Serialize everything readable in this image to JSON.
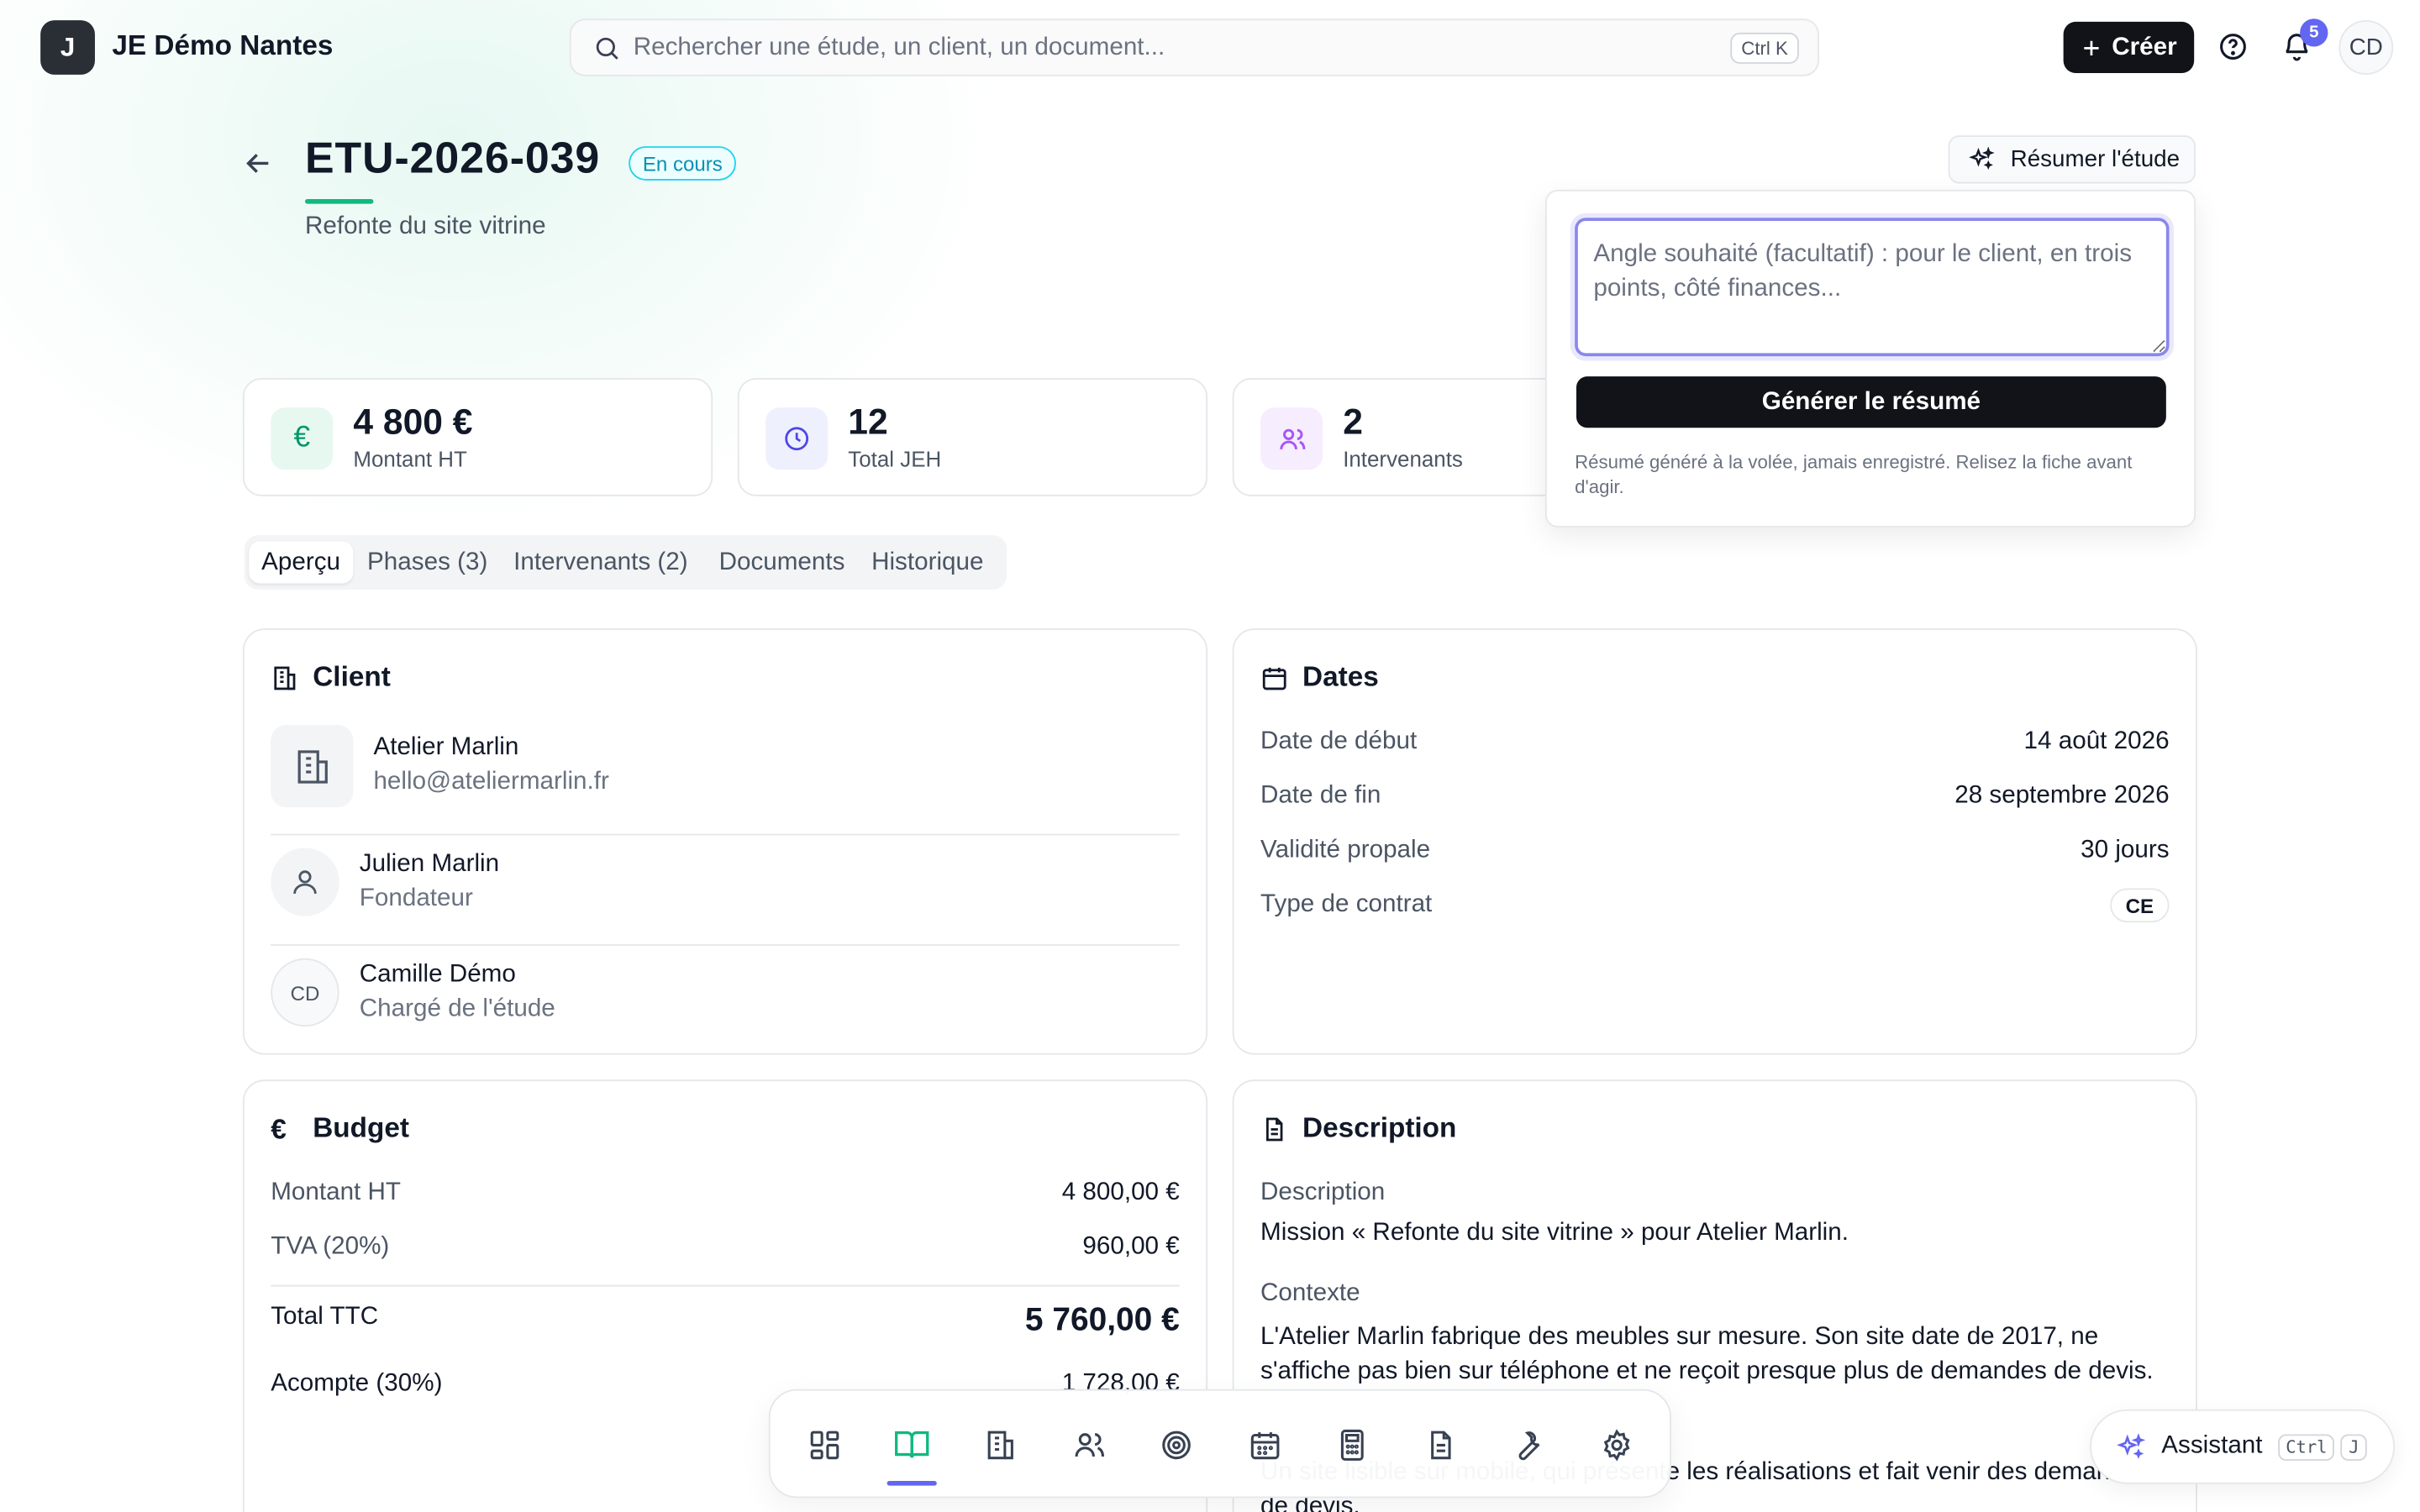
{
  "topbar": {
    "logo_letter": "J",
    "org_name": "JE Démo Nantes",
    "search_placeholder": "Rechercher une étude, un client, un document...",
    "search_shortcut": "Ctrl K",
    "create_label": "Créer",
    "notifications_count": "5",
    "avatar_initials": "CD"
  },
  "header": {
    "study_id": "ETU-2026-039",
    "status": "En cours",
    "subtitle": "Refonte du site vitrine",
    "resume_label": "Résumer l'étude"
  },
  "popover": {
    "placeholder": "Angle souhaité (facultatif) : pour le client, en trois points, côté finances...",
    "generate_label": "Générer le résumé",
    "note": "Résumé généré à la volée, jamais enregistré. Relisez la fiche avant d'agir."
  },
  "kpis": [
    {
      "value": "4 800 €",
      "label": "Montant HT",
      "icon": "euro-icon"
    },
    {
      "value": "12",
      "label": "Total JEH",
      "icon": "clock-icon"
    },
    {
      "value": "2",
      "label": "Intervenants",
      "icon": "users-icon"
    }
  ],
  "tabs": [
    "Aperçu",
    "Phases (3)",
    "Intervenants (2)",
    "Documents",
    "Historique"
  ],
  "client": {
    "title": "Client",
    "company_name": "Atelier Marlin",
    "company_email": "hello@ateliermarlin.fr",
    "contact_name": "Julien Marlin",
    "contact_role": "Fondateur",
    "owner_initials": "CD",
    "owner_name": "Camille Démo",
    "owner_role": "Chargé de l'étude"
  },
  "dates": {
    "title": "Dates",
    "rows": [
      {
        "label": "Date de début",
        "value": "14 août 2026"
      },
      {
        "label": "Date de fin",
        "value": "28 septembre 2026"
      },
      {
        "label": "Validité propale",
        "value": "30 jours"
      },
      {
        "label": "Type de contrat",
        "value": "CE"
      }
    ]
  },
  "budget": {
    "title": "Budget",
    "ht_label": "Montant HT",
    "ht_value": "4 800,00 €",
    "tva_label": "TVA (20%)",
    "tva_value": "960,00 €",
    "ttc_label": "Total TTC",
    "ttc_value": "5 760,00 €",
    "acompte_label": "Acompte (30%)",
    "acompte_value": "1 728,00 €"
  },
  "description": {
    "title": "Description",
    "desc_label": "Description",
    "desc_text": "Mission « Refonte du site vitrine » pour Atelier Marlin.",
    "context_label": "Contexte",
    "context_text": "L'Atelier Marlin fabrique des meubles sur mesure. Son site date de 2017, ne s'affiche pas bien sur téléphone et ne reçoit presque plus de demandes de devis.",
    "objective_text": "Un site lisible sur mobile, qui présente les réalisations et fait venir des demandes de devis."
  },
  "dock": [
    "dashboard-icon",
    "book-icon",
    "building-icon",
    "users-icon",
    "target-icon",
    "calendar-icon",
    "calculator-icon",
    "document-icon",
    "wrench-icon",
    "settings-icon"
  ],
  "assistant": {
    "label": "Assistant",
    "key1": "Ctrl",
    "key2": "J"
  },
  "colors": {
    "accent": "#10b981",
    "brand": "#6366f1",
    "status": "#0891b2",
    "dark": "#111318"
  }
}
